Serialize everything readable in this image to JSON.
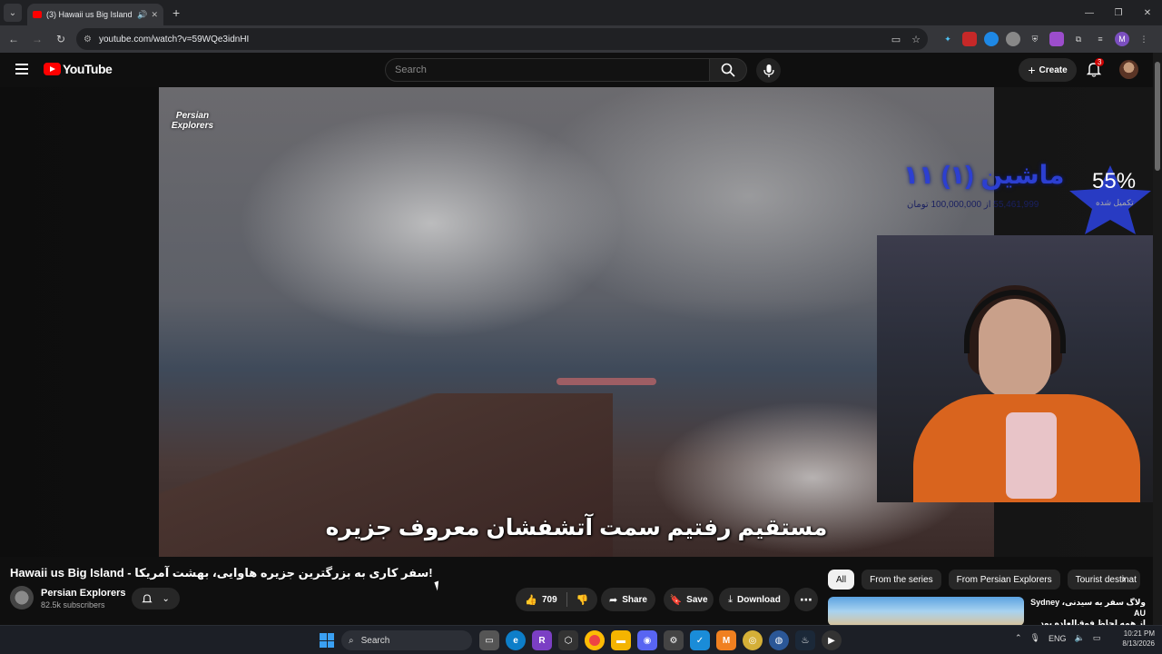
{
  "browser": {
    "tab_title": "(3) Hawaii us Big Island - س...",
    "url": "youtube.com/watch?v=59WQe3idnHI",
    "profile_initial": "M"
  },
  "youtube": {
    "logo_text": "YouTube",
    "search_placeholder": "Search",
    "create_label": "Create",
    "notification_count": "3"
  },
  "video": {
    "watermark": "Persian Explorers",
    "subtitle": "مستقیم رفتیم سمت آتشفشان معروف جزیره",
    "goal_title": "ماشین (۱) ۱۱",
    "goal_amount": "55,461,999 از 100,000,000 تومان",
    "goal_percent": "55%",
    "goal_percent_label": "تکمیل شده",
    "title": "Hawaii us Big Island - سفر کاری به بزرگترین جزیره هاوایی، بهشت آمریکا!"
  },
  "channel": {
    "name": "Persian Explorers",
    "subscribers": "82.5k subscribers"
  },
  "actions": {
    "likes": "709",
    "share": "Share",
    "save": "Save",
    "download": "Download"
  },
  "chips": [
    "All",
    "From the series",
    "From Persian Explorers",
    "Tourist destinat"
  ],
  "recommendation": {
    "title_line1": "ولاگ سفر به سیدنی، Sydney AU",
    "title_line2": "از همه لحاظ فوق‌العاده بود 😍"
  },
  "taskbar": {
    "search_label": "Search",
    "language": "ENG",
    "time": "10:21 PM",
    "date": "8/13/2026"
  },
  "colors": {
    "youtube_red": "#ff0000",
    "goal_blue": "#2c3fd1",
    "chip_active": "#f1f1f1"
  }
}
